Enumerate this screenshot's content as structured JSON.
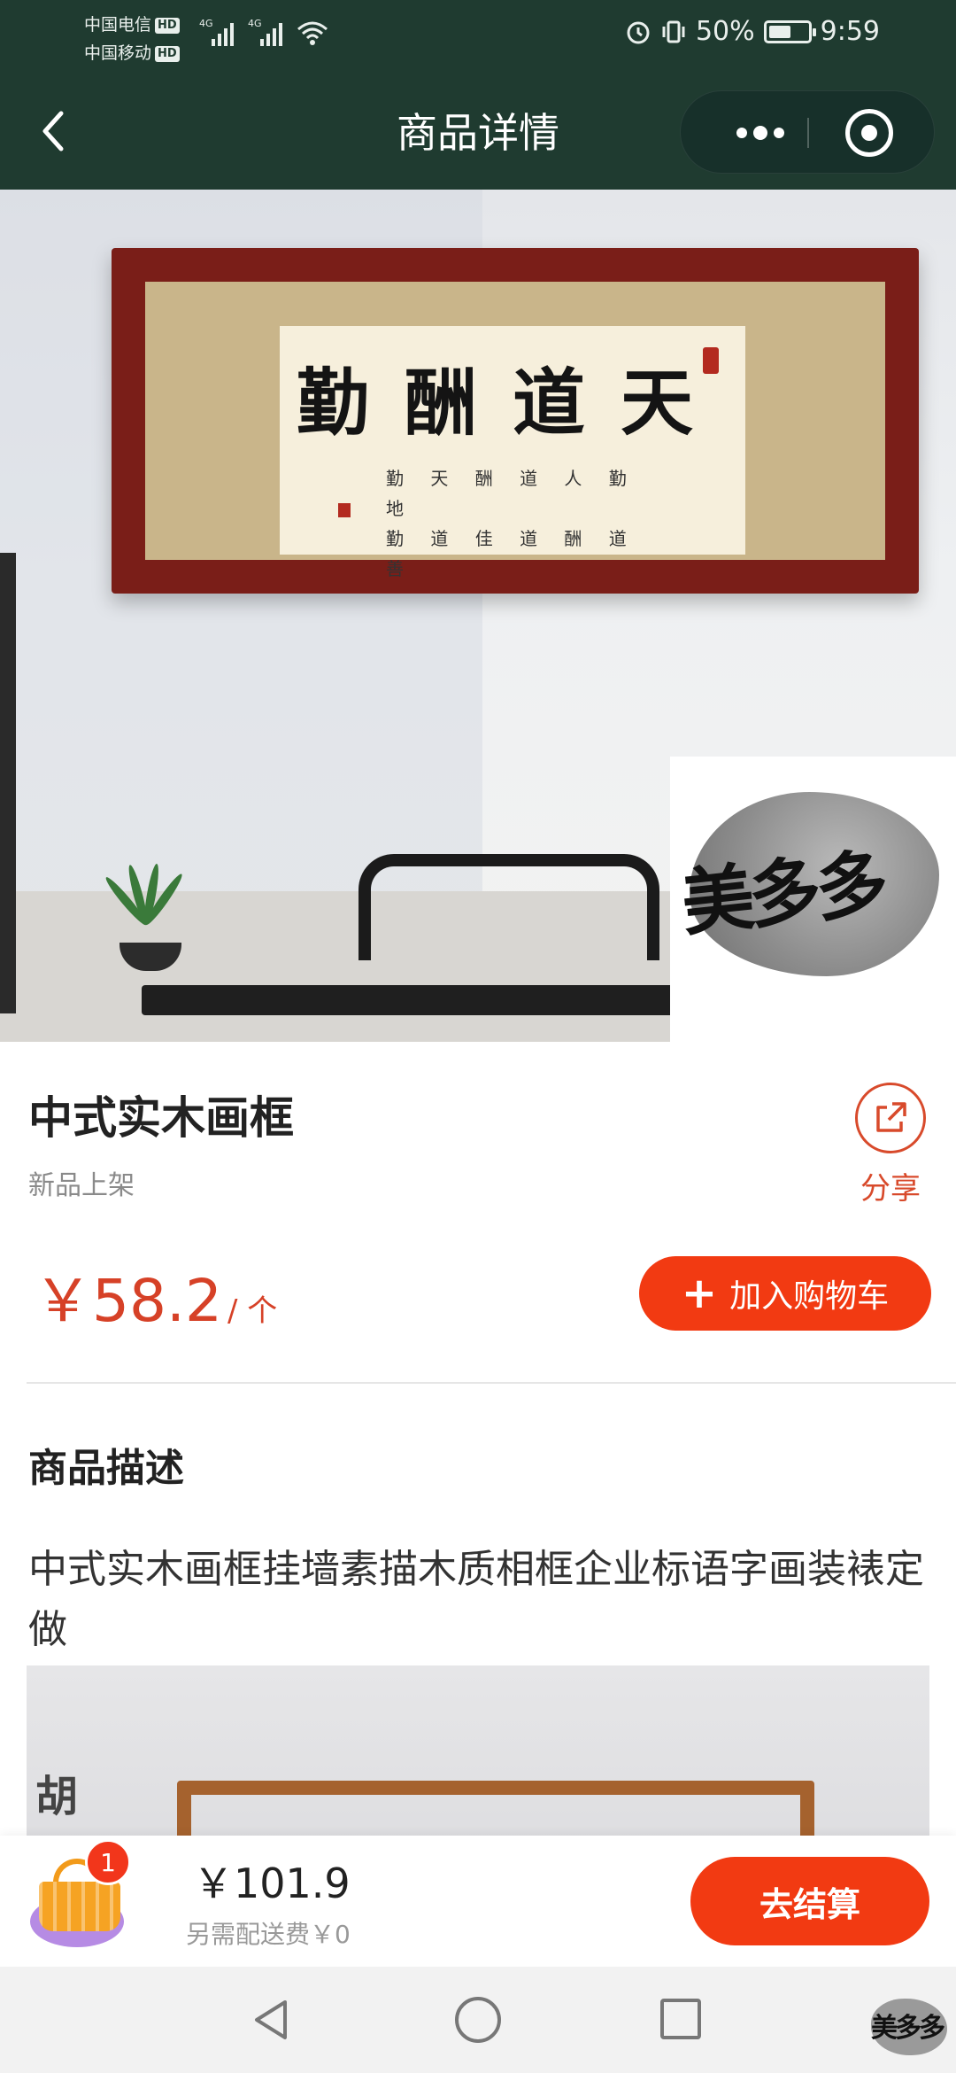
{
  "status_bar": {
    "carrier_1": "中国电信",
    "carrier_2": "中国移动",
    "hd_label": "HD",
    "network_label": "4G",
    "battery": "50%",
    "time": "9:59"
  },
  "header": {
    "title": "商品详情"
  },
  "hero_image": {
    "calligraphy_main": "天道酬勤",
    "watermark_logo": "美多多"
  },
  "product": {
    "name": "中式实木画框",
    "tag": "新品上架",
    "share_label": "分享",
    "price": "￥58.2",
    "unit": "/ 个",
    "add_to_cart_label": "加入购物车"
  },
  "description": {
    "heading": "商品描述",
    "body": "中式实木画框挂墙素描木质相框企业标语字画装裱定做",
    "image_caption_char": "胡"
  },
  "cart_bar": {
    "badge_count": "1",
    "total": "￥101.9",
    "shipping": "另需配送费￥0",
    "checkout_label": "去结算"
  },
  "nav_bar": {
    "logo_text": "美多多"
  },
  "colors": {
    "header_bg": "#1f3b30",
    "accent": "#f23a12",
    "price": "#d64127"
  },
  "icons": [
    "back-chevron-icon",
    "more-dots-icon",
    "close-target-icon",
    "share-icon",
    "plus-icon",
    "basket-icon",
    "alarm-icon",
    "vibrate-icon",
    "wifi-icon",
    "battery-icon",
    "nav-back-icon",
    "nav-home-icon",
    "nav-recent-icon"
  ]
}
